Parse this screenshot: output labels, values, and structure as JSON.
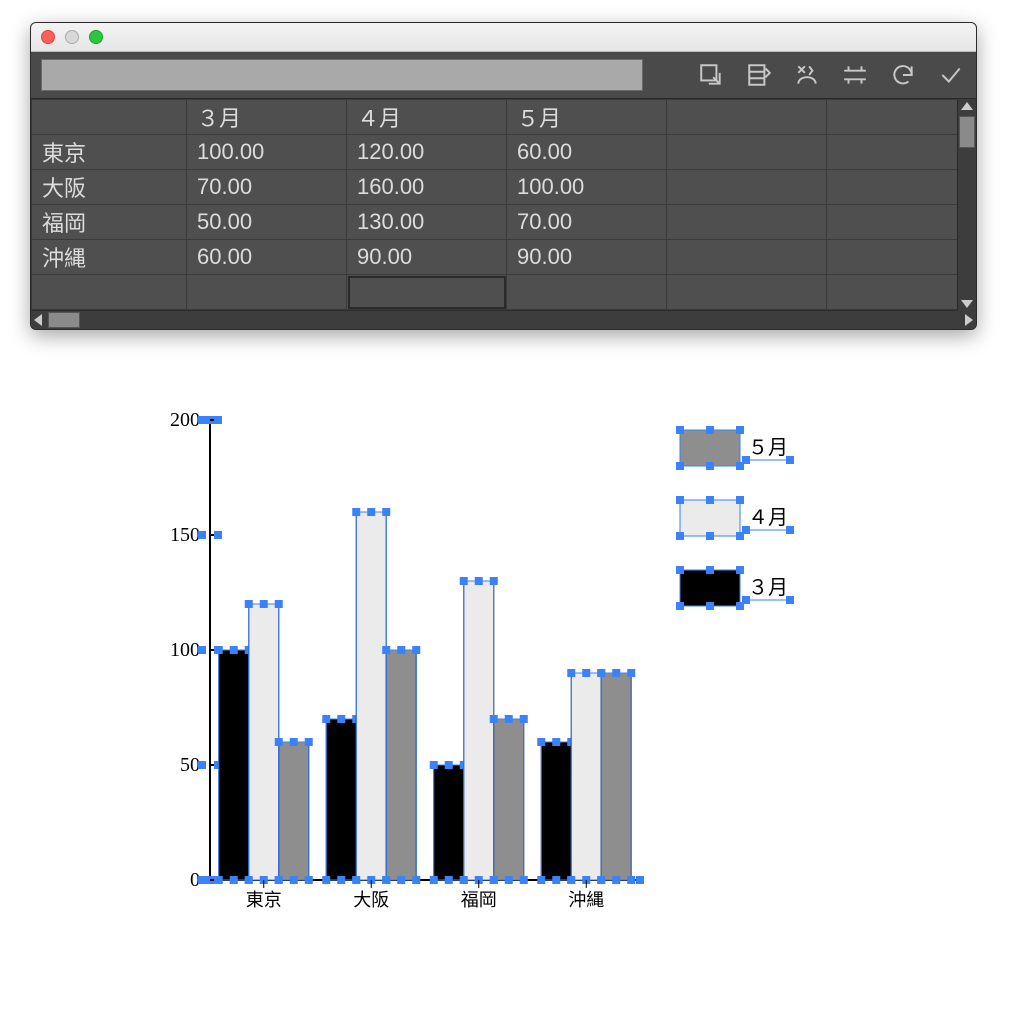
{
  "table": {
    "columns": [
      "３月",
      "４月",
      "５月"
    ],
    "rows": [
      {
        "name": "東京",
        "cells": [
          "100.00",
          "120.00",
          "60.00"
        ]
      },
      {
        "name": "大阪",
        "cells": [
          "70.00",
          "160.00",
          "100.00"
        ]
      },
      {
        "name": "福岡",
        "cells": [
          "50.00",
          "130.00",
          "70.00"
        ]
      },
      {
        "name": "沖縄",
        "cells": [
          "60.00",
          "90.00",
          "90.00"
        ]
      }
    ]
  },
  "chart_data": {
    "type": "bar",
    "categories": [
      "東京",
      "大阪",
      "福岡",
      "沖縄"
    ],
    "series": [
      {
        "name": "３月",
        "values": [
          100,
          70,
          50,
          60
        ],
        "color": "#000000"
      },
      {
        "name": "４月",
        "values": [
          120,
          160,
          130,
          90
        ],
        "color": "#ebebeb"
      },
      {
        "name": "５月",
        "values": [
          60,
          100,
          70,
          90
        ],
        "color": "#8e8e8e"
      }
    ],
    "ylim": [
      0,
      200
    ],
    "yticks": [
      0,
      50,
      100,
      150,
      200
    ],
    "legend_order": [
      "５月",
      "４月",
      "３月"
    ],
    "title": "",
    "xlabel": "",
    "ylabel": ""
  }
}
